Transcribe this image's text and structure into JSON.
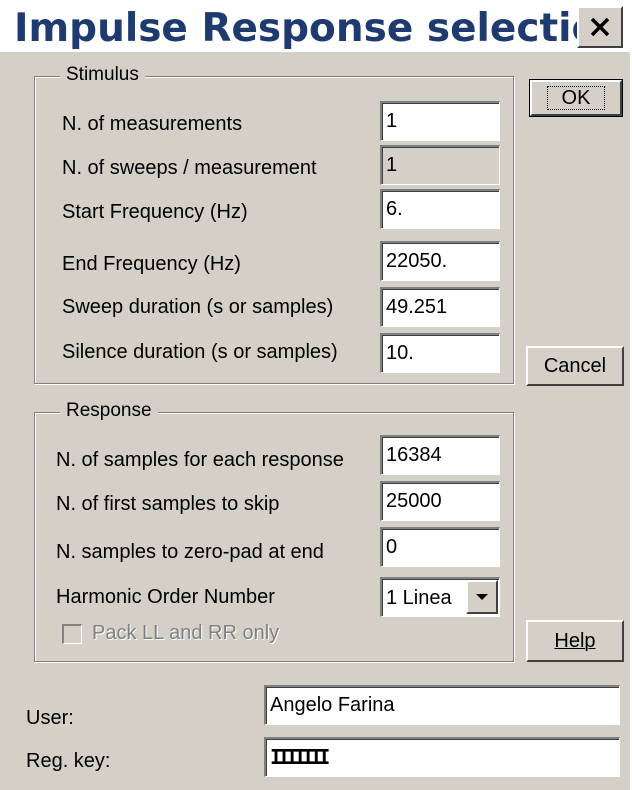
{
  "window": {
    "title": "Impulse Response selection",
    "close_icon": "close-icon"
  },
  "stimulus": {
    "legend": "Stimulus",
    "fields": [
      {
        "label": "N. of measurements",
        "value": "1",
        "enabled": true
      },
      {
        "label": "N. of sweeps / measurement",
        "value": "1",
        "enabled": false
      },
      {
        "label": "Start Frequency (Hz)",
        "value": "6.",
        "enabled": true
      },
      {
        "label": "End Frequency (Hz)",
        "value": "22050.",
        "enabled": true
      },
      {
        "label": "Sweep duration (s or samples)",
        "value": "49.251",
        "enabled": true
      },
      {
        "label": "Silence duration (s or samples)",
        "value": "10.",
        "enabled": true
      }
    ]
  },
  "response": {
    "legend": "Response",
    "fields": [
      {
        "label": "N. of samples for each response",
        "value": "16384"
      },
      {
        "label": "N. of first samples to skip",
        "value": "25000"
      },
      {
        "label": "N. samples to zero-pad at end",
        "value": "0"
      }
    ],
    "harmonic_label": "Harmonic Order Number",
    "harmonic_value": "1 Linea",
    "pack_label": "Pack LL and RR only",
    "pack_checked": false
  },
  "buttons": {
    "ok": "OK",
    "cancel": "Cancel",
    "help": "Help"
  },
  "user": {
    "label": "User:",
    "value": "Angelo Farina"
  },
  "regkey": {
    "label": "Reg. key:",
    "value": "IIIIIII"
  }
}
